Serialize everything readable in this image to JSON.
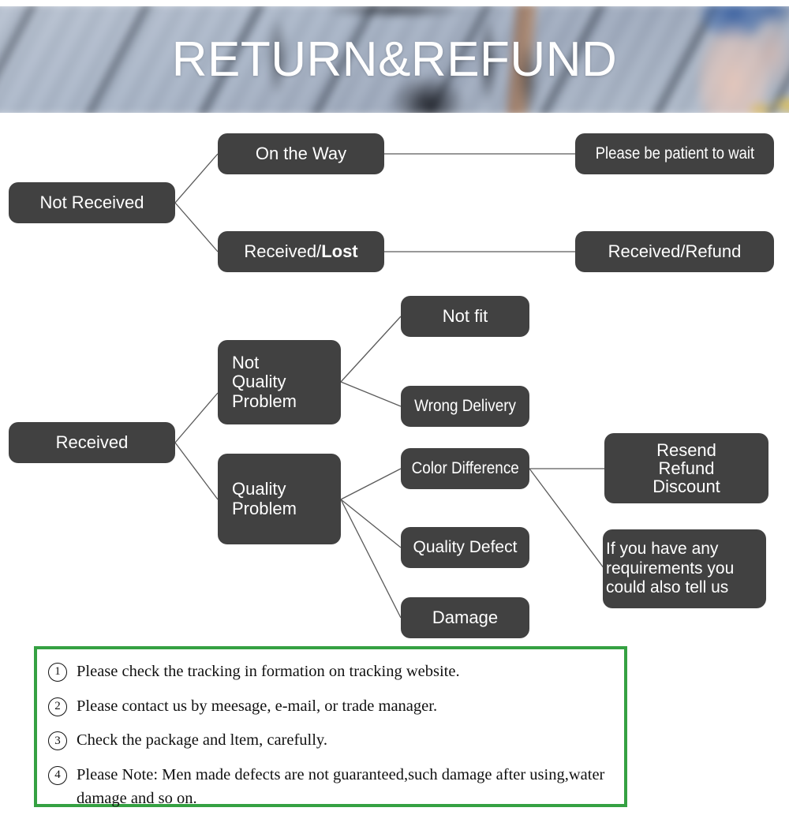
{
  "banner": {
    "title": "RETURN&REFUND",
    "background_description": "blurred-deck-photo",
    "colors": {
      "deck": "#aab6c8",
      "denim": "#3a60a0",
      "accent_yellow": "#ecc43e"
    }
  },
  "flowchart": {
    "box_color": "#414141",
    "text_color": "#ffffff",
    "line_color": "#5a5a5a",
    "nodes": [
      {
        "id": "not-received",
        "label": "Not Received"
      },
      {
        "id": "on-the-way",
        "label": "On the Way"
      },
      {
        "id": "received-lost",
        "label_plain": "Received/",
        "label_bold": "Lost"
      },
      {
        "id": "please-wait",
        "label": "Please be patient to wait"
      },
      {
        "id": "received-refund",
        "label": "Received/Refund"
      },
      {
        "id": "received",
        "label": "Received"
      },
      {
        "id": "not-quality-problem",
        "label": "Not\nQuality\nProblem"
      },
      {
        "id": "quality-problem",
        "label": "Quality\nProblem"
      },
      {
        "id": "not-fit",
        "label": "Not fit"
      },
      {
        "id": "wrong-delivery",
        "label": "Wrong Delivery"
      },
      {
        "id": "color-difference",
        "label": "Color Difference"
      },
      {
        "id": "quality-defect",
        "label": "Quality Defect"
      },
      {
        "id": "damage",
        "label": "Damage"
      },
      {
        "id": "resend-refund-discount",
        "label": "Resend\nRefund\nDiscount"
      },
      {
        "id": "requirements",
        "label": "If you have any\nrequirements you\ncould also tell us"
      }
    ]
  },
  "notes": {
    "border_color": "#35a142",
    "items": [
      {
        "num": "1",
        "text": "Please check the tracking in formation on tracking website."
      },
      {
        "num": "2",
        "text": "Please contact us by meesage, e-mail, or trade manager."
      },
      {
        "num": "3",
        "text": "Check the package and ltem, carefully."
      },
      {
        "num": "4",
        "text": "Please Note: Men made defects  are not guaranteed,such damage after using,water damage and so on."
      }
    ]
  }
}
